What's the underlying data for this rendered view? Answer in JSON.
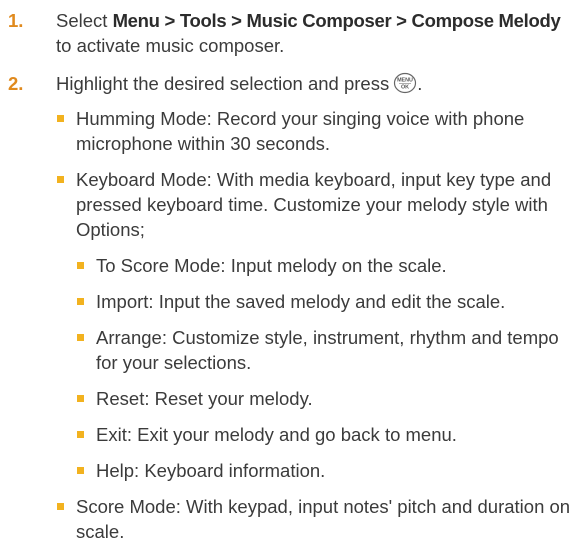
{
  "steps": [
    {
      "number": "1.",
      "prefix": "Select ",
      "menu_path": "Menu > Tools > Music Composer > Compose Melody",
      "suffix": " to activate music composer."
    },
    {
      "number": "2.",
      "text": "Highlight the desired selection and press",
      "key_icon": "menu-ok-key-icon",
      "key_label_top": "MENU",
      "key_label_bottom": "OK",
      "after_key": ".",
      "bullets": [
        {
          "text": "Humming Mode: Record your singing voice with phone microphone within 30 seconds."
        },
        {
          "text": "Keyboard Mode: With media keyboard, input key type and pressed keyboard time. Customize your melody style with Options;",
          "sub_bullets": [
            "To Score Mode: Input melody on the scale.",
            "Import: Input the saved melody and edit the scale.",
            "Arrange: Customize style, instrument, rhythm and tempo for your selections.",
            "Reset: Reset your melody.",
            "Exit: Exit your melody and go back to menu.",
            "Help: Keyboard information."
          ]
        },
        {
          "text": "Score Mode: With keypad, input notes' pitch and duration on scale."
        }
      ]
    }
  ],
  "colors": {
    "step_number": "#e08a1e",
    "bullet": "#f2b21f",
    "text": "#3b3b3b"
  }
}
